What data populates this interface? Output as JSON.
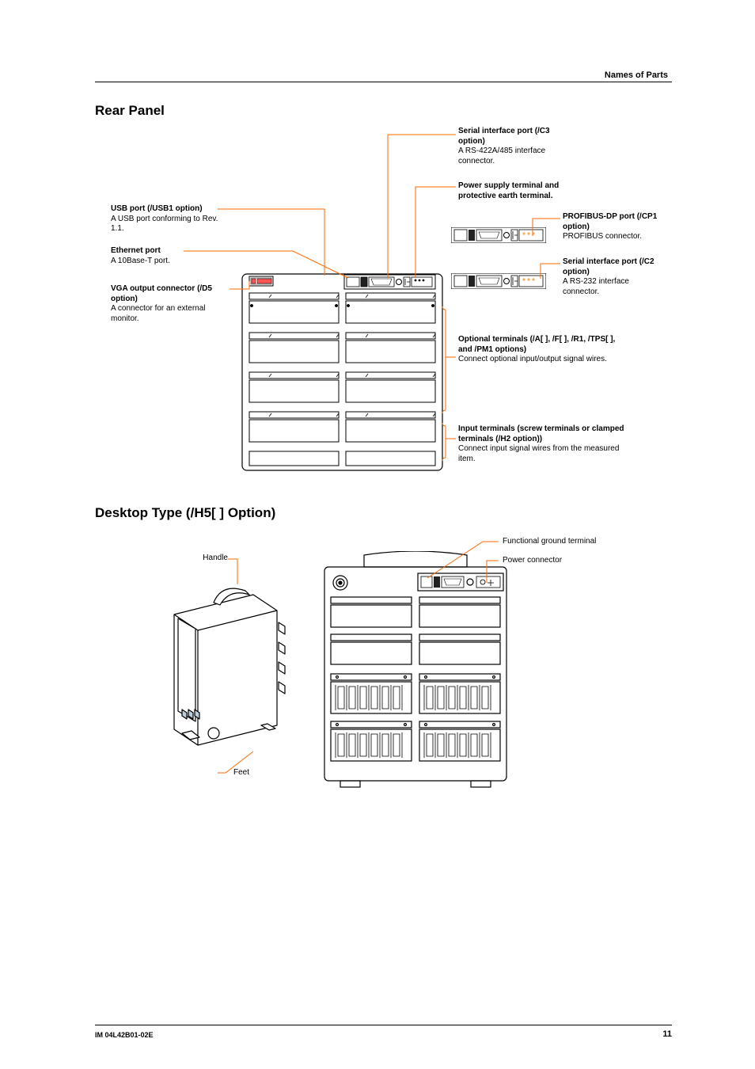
{
  "header": {
    "section": "Names of Parts"
  },
  "section1": {
    "title": "Rear Panel",
    "callouts": {
      "usb": {
        "title": "USB port (/USB1 option)",
        "body": "A USB port conforming to Rev. 1.1."
      },
      "eth": {
        "title": "Ethernet port",
        "body": "A 10Base-T port."
      },
      "vga": {
        "title": "VGA output connector (/D5 option)",
        "body": "A connector for an external monitor."
      },
      "serialc3": {
        "title": "Serial interface port (/C3 option)",
        "body": "A RS-422A/485 interface connector."
      },
      "power": {
        "title": "Power supply terminal and protective earth terminal."
      },
      "profibus": {
        "title": "PROFIBUS-DP port (/CP1 option)",
        "body": "PROFIBUS connector."
      },
      "serialc2": {
        "title": "Serial interface port (/C2 option)",
        "body": "A RS-232 interface connector."
      },
      "optional": {
        "title": "Optional terminals (/A[ ], /F[ ], /R1, /TPS[ ], and /PM1 options)",
        "body": "Connect optional input/output signal wires."
      },
      "input": {
        "title": "Input terminals (screw terminals or clamped terminals (/H2 option))",
        "body": "Connect input signal wires from the measured item."
      }
    }
  },
  "section2": {
    "title": "Desktop Type (/H5[ ] Option)",
    "callouts": {
      "handle": "Handle",
      "feet": "Feet",
      "ground": "Functional ground terminal",
      "powerconn": "Power connector"
    }
  },
  "footer": {
    "left": "IM 04L42B01-02E",
    "right": "11"
  }
}
